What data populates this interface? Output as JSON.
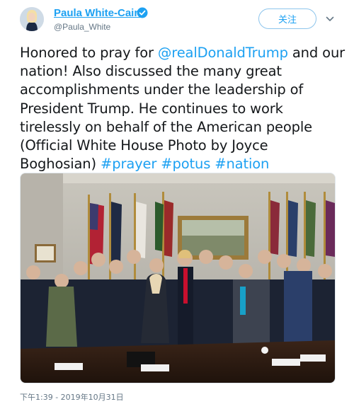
{
  "author": {
    "display_name": "Paula White-Cain",
    "handle": "@Paula_White",
    "verified": true
  },
  "follow_button": {
    "label": "关注"
  },
  "tweet": {
    "segments": [
      {
        "text": "Honored to pray for ",
        "type": "text"
      },
      {
        "text": "@realDonaldTrump",
        "type": "link"
      },
      {
        "text": " and our nation! Also discussed the many great accomplishments under the leadership of President Trump. He continues to work tirelessly on behalf of the American people (Official White House Photo by Joyce Boghosian) ",
        "type": "text"
      },
      {
        "text": "#prayer",
        "type": "link"
      },
      {
        "text": " ",
        "type": "text"
      },
      {
        "text": "#potus",
        "type": "link"
      },
      {
        "text": " ",
        "type": "text"
      },
      {
        "text": "#nation",
        "type": "link"
      }
    ]
  },
  "timestamp": "下午1:39 - 2019年10月31日",
  "colors": {
    "accent": "#1da1f2",
    "text": "#14171a",
    "muted": "#657786"
  },
  "icons": {
    "verified": "verified-badge-icon",
    "menu": "chevron-down-icon"
  }
}
